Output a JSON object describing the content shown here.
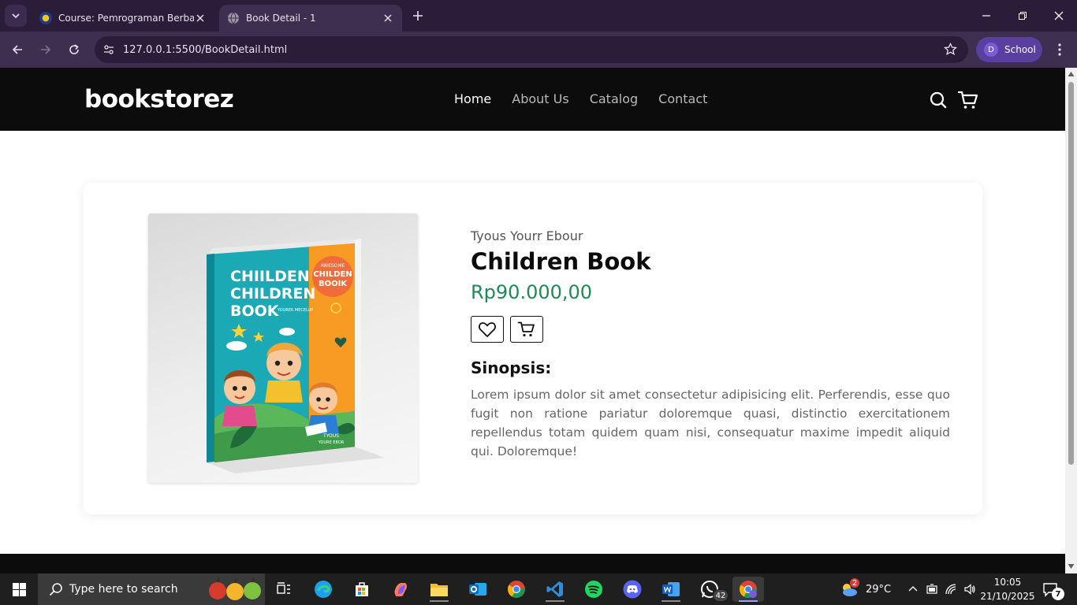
{
  "browser": {
    "tabs": [
      {
        "title": "Course: Pemrograman Berbasis",
        "active": false
      },
      {
        "title": "Book Detail - 1",
        "active": true
      }
    ],
    "url": "127.0.0.1:5500/BookDetail.html",
    "profile_initial": "D",
    "profile_label": "School"
  },
  "site": {
    "brand": "bookstorez",
    "nav": [
      "Home",
      "About Us",
      "Catalog",
      "Contact"
    ],
    "active_nav": "Home"
  },
  "book": {
    "author": "Tyous Yourr Ebour",
    "title": "Children Book",
    "price": "Rp90.000,00",
    "synopsis_heading": "Sinopsis:",
    "synopsis": "Lorem ipsum dolor sit amet consectetur adipisicing elit. Perferendis, esse quo fugit non ratione pariatur doloremque quasi, distinctio exercitationem repellendus totam quidem quam nisi, consequatur maxime impedit aliquid qui. Doloremque!",
    "cover": {
      "title_lines": [
        "CHIILDEN",
        "CHILDREN",
        "BOOK"
      ],
      "side_text": "YOUREK MECELUP",
      "badge_lines": [
        "AWESOME",
        "CHILDEN",
        "BOOIK"
      ],
      "footer_lines": [
        "TYOUS",
        "YOURE EBOR"
      ]
    }
  },
  "taskbar": {
    "search_placeholder": "Type here to search",
    "weather_badge": "2",
    "weather": "29°C",
    "whatsapp_badge": "42",
    "time": "10:05",
    "date": "21/10/2025",
    "notifications": "7"
  },
  "colors": {
    "chrome_dark": "#2b1d3a",
    "chrome_mid": "#3e2f51",
    "header_bg": "#0c0c0c",
    "price_green": "#1f8a56"
  }
}
